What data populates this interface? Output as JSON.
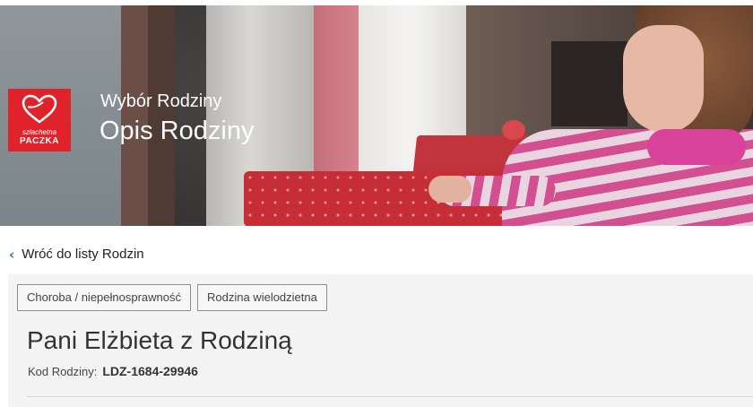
{
  "logo": {
    "line1": "szlachetna",
    "line2": "PACZKA",
    "color": "#e0222b"
  },
  "header": {
    "subtitle": "Wybór Rodziny",
    "title": "Opis Rodziny"
  },
  "nav": {
    "back_label": "Wróć do listy Rodzin",
    "back_icon": "chevron-left-icon"
  },
  "family": {
    "tags": [
      "Choroba / niepełnosprawność",
      "Rodzina wielodzietna"
    ],
    "name": "Pani Elżbieta z Rodziną",
    "code_label": "Kod Rodziny:",
    "code_value": "LDZ-1684-29946"
  },
  "colors": {
    "accent": "#1b74c8",
    "card_bg": "#f4f4f4"
  }
}
